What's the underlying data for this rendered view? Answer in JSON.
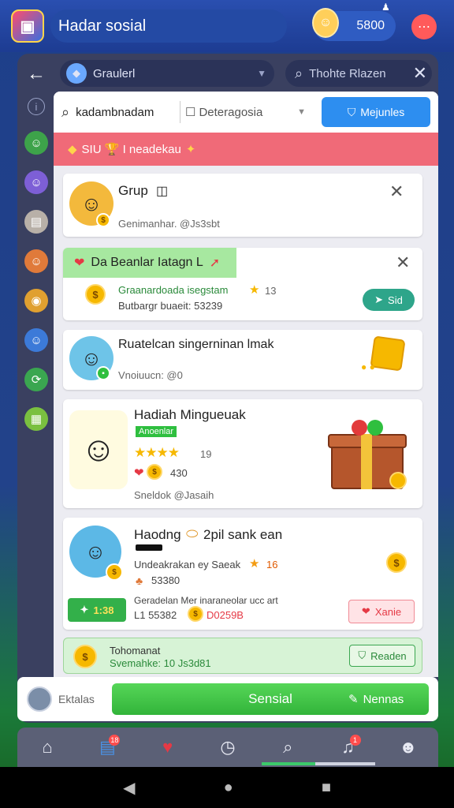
{
  "topbar": {
    "app_title": "Hadar sosial",
    "coins": "5800",
    "logo_icon": "app-logo-icon",
    "menu_icon": "dots-icon"
  },
  "nav": {
    "group_label": "Graulerl",
    "search_placeholder": "Thohte Rlazen"
  },
  "filter": {
    "search_value": "kadambnadam",
    "select_value": "Deteragosia",
    "primary_label": "Mejunles"
  },
  "banner": {
    "text": "SIU 🏆 I neadekau"
  },
  "cards": {
    "c1": {
      "title": "Grup",
      "sub": "Genimanhar. @Js3sbt"
    },
    "c2": {
      "highlight": "Da Beanlar Iatagn L",
      "line1": "Graanardoada isegstam",
      "line1_num": "13",
      "line2": "Butbargr buaeit: 53239",
      "button": "Sid"
    },
    "c3": {
      "title": "Ruatelcan singerninan lmak",
      "sub": "Vnoiuucn: @0"
    },
    "c4": {
      "title": "Hadiah Mingueuak",
      "tag": "Anoenlar",
      "rating": "19",
      "hearts": "430",
      "sub": "Sneldok @Jasaih"
    },
    "c5": {
      "title": "Haodng",
      "title2": "2pil sank ean",
      "line1": "Undeakrakan ey Saeak",
      "line1_num": "16",
      "line2": "53380",
      "line3": "Geradelan Mer inaraneolar ucc art",
      "line4_a": "L1 55382",
      "line4_b": "D0259B",
      "left_btn": "1:38",
      "right_btn": "Xanie"
    }
  },
  "footer": {
    "title": "Tohomanat",
    "sub": "Svemahke: 10 Js3d81",
    "button": "Readen"
  },
  "action_bar": {
    "left_label": "Ektalas",
    "primary": "Sensial",
    "secondary": "Nennas"
  },
  "tabs": [
    {
      "name": "home-icon",
      "badge": ""
    },
    {
      "name": "message-icon",
      "badge": "18"
    },
    {
      "name": "heart-icon",
      "badge": ""
    },
    {
      "name": "clock-icon",
      "badge": ""
    },
    {
      "name": "search-icon",
      "badge": ""
    },
    {
      "name": "bell-icon",
      "badge": "1"
    },
    {
      "name": "profile-icon",
      "badge": ""
    }
  ],
  "colors": {
    "accent_blue": "#2d8ef0",
    "banner_red": "#f06a78",
    "success_green": "#3cc96a"
  }
}
